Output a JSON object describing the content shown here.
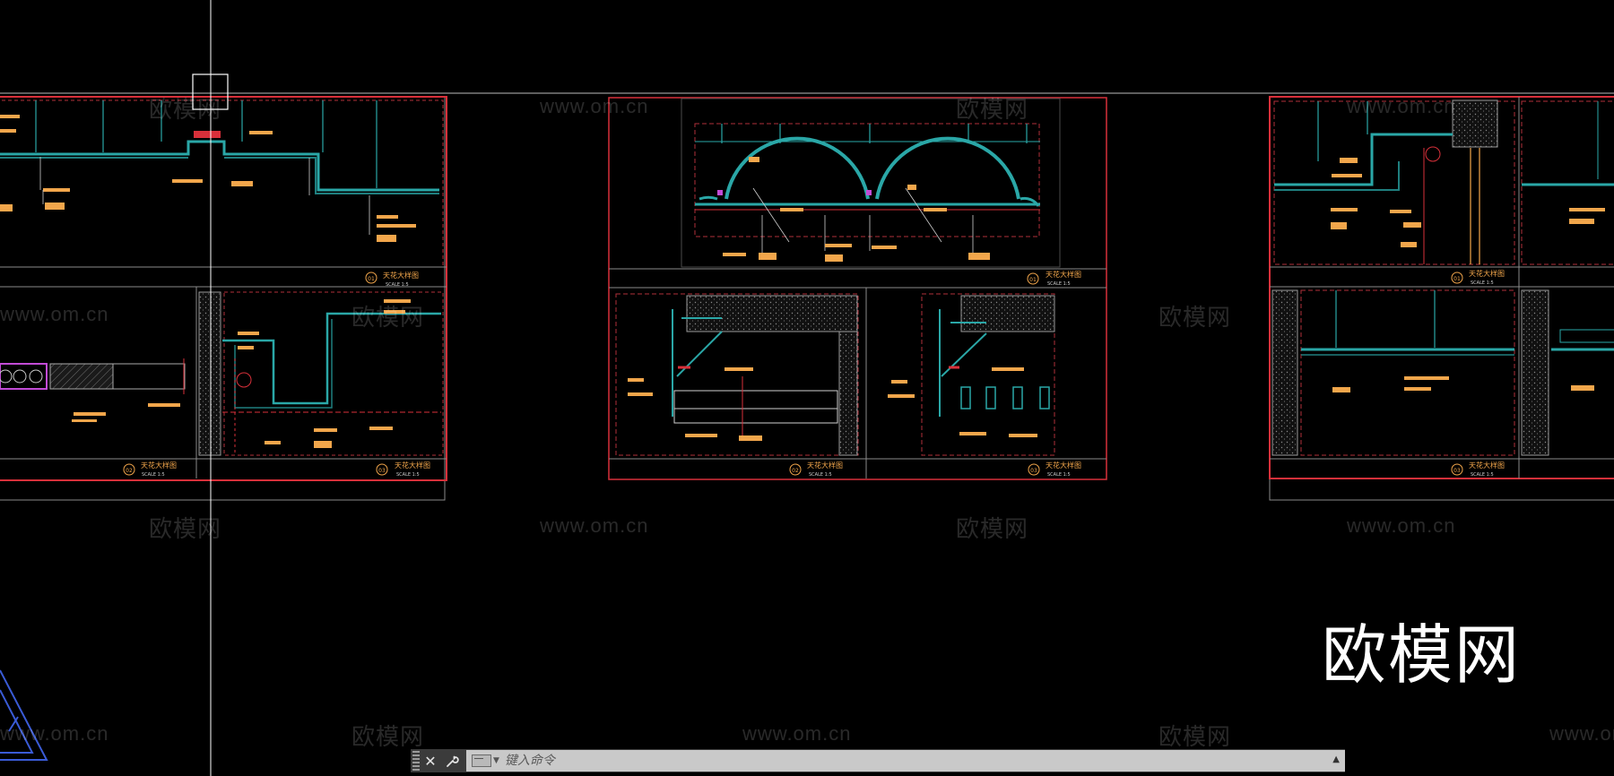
{
  "app": {
    "type": "CAD drawing workspace",
    "colors": {
      "background": "#000000",
      "frame_red": "#d8303a",
      "frame_gray": "#9a9a9a",
      "line_cyan": "#2aa7a7",
      "label_orange": "#f2a64b",
      "crosshair": "#ffffff",
      "magenta": "#c24bd6"
    }
  },
  "watermarks": {
    "brand_small": "欧模网",
    "url": "www.om.cn",
    "brand_large": "欧模网"
  },
  "sheets": [
    {
      "id": "sheet-left",
      "details": [
        {
          "number": "01",
          "title": "天花大样图",
          "scale": "SCALE 1:5"
        },
        {
          "number": "02",
          "title": "天花大样图",
          "scale": "SCALE 1:5"
        },
        {
          "number": "03",
          "title": "天花大样图",
          "scale": "SCALE 1:5"
        }
      ]
    },
    {
      "id": "sheet-middle",
      "details": [
        {
          "number": "01",
          "title": "天花大样图",
          "scale": "SCALE 1:5"
        },
        {
          "number": "02",
          "title": "天花大样图",
          "scale": "SCALE 1:5"
        },
        {
          "number": "03",
          "title": "天花大样图",
          "scale": "SCALE 1:5"
        }
      ]
    },
    {
      "id": "sheet-right",
      "details": [
        {
          "number": "01",
          "title": "天花大样图",
          "scale": "SCALE 1:5"
        },
        {
          "number": "03",
          "title": "天花大样图",
          "scale": "SCALE 1:5"
        }
      ]
    }
  ],
  "command_line": {
    "close_icon": "close-icon",
    "customize_icon": "wrench-icon",
    "prompt_icon": "command-prompt-icon",
    "placeholder": "键入命令",
    "history_icon": "caret-up-icon"
  }
}
